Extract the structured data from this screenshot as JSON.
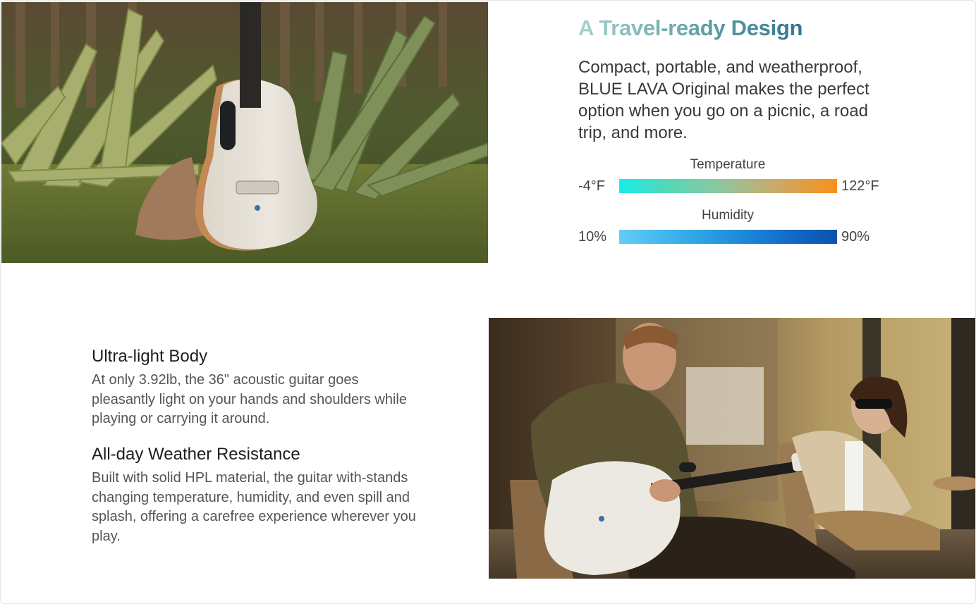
{
  "travel": {
    "title": "A Travel-ready Design",
    "body": "Compact, portable, and weatherproof, BLUE LAVA Original makes the perfect option when you go on a picnic, a road trip, and more."
  },
  "temperature": {
    "label": "Temperature",
    "min": "-4°F",
    "max": "122°F",
    "colors": [
      "#18ecec",
      "#f8901a"
    ]
  },
  "humidity": {
    "label": "Humidity",
    "min": "10%",
    "max": "90%",
    "colors": [
      "#62cdf6",
      "#0a52ad"
    ]
  },
  "features": [
    {
      "title": "Ultra-light Body",
      "body": "At only 3.92lb, the 36\" acoustic guitar goes pleasantly light on your hands and shoulders while playing or carrying it around."
    },
    {
      "title": "All-day Weather Resistance",
      "body": "Built with solid HPL material, the guitar with-stands changing temperature, humidity, and even spill and splash, offering a carefree experience wherever you play."
    }
  ]
}
